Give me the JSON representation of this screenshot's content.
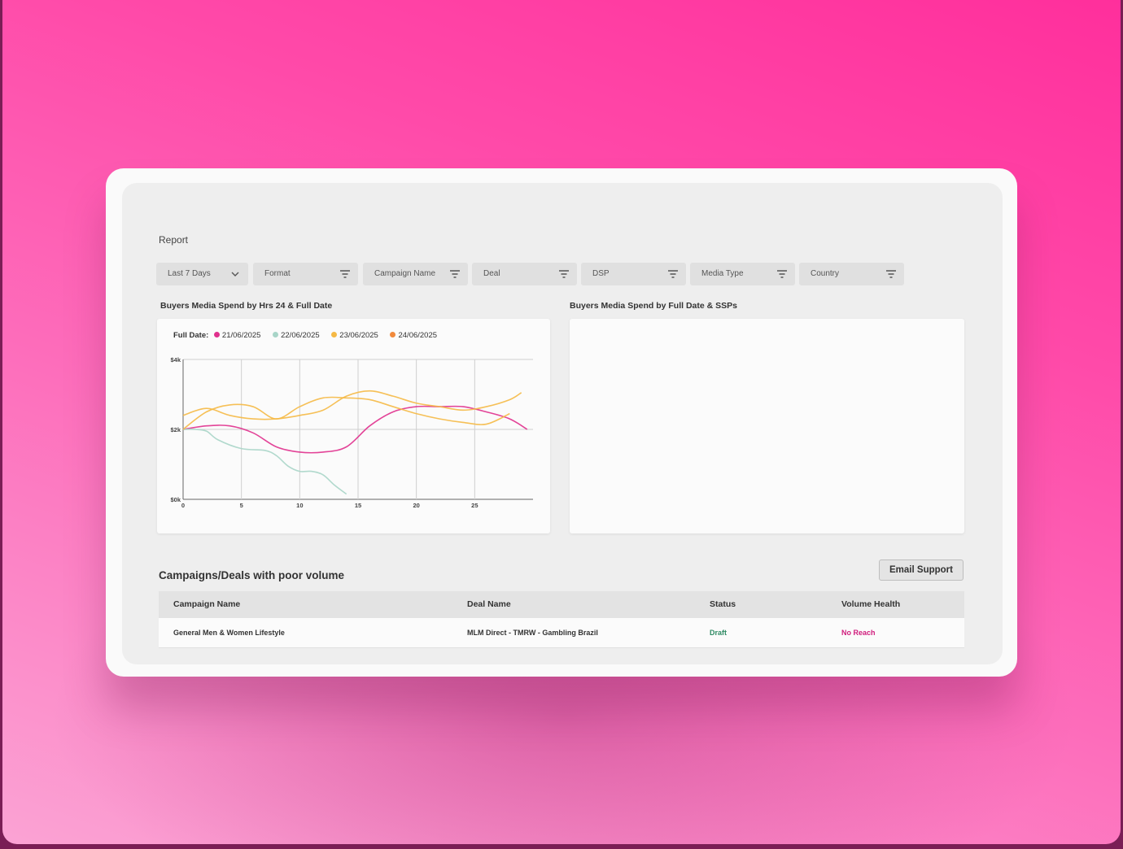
{
  "page": {
    "title": "Report"
  },
  "filters": [
    {
      "label": "Last 7 Days",
      "icon": "chevron-down-icon"
    },
    {
      "label": "Format",
      "icon": "filter-icon"
    },
    {
      "label": "Campaign Name",
      "icon": "filter-icon"
    },
    {
      "label": "Deal",
      "icon": "filter-icon"
    },
    {
      "label": "DSP",
      "icon": "filter-icon"
    },
    {
      "label": "Media Type",
      "icon": "filter-icon"
    },
    {
      "label": "Country",
      "icon": "filter-icon"
    }
  ],
  "colors": {
    "background": "#ff3fa4",
    "series_1": "#e0308d",
    "series_2": "#a8d5c8",
    "series_3": "#f5b945",
    "series_4": "#f18a3c",
    "status_draft": "#2e8a63",
    "health_no_reach": "#d01d7d"
  },
  "chart_data": [
    {
      "type": "line",
      "title": "Buyers Media Spend by Hrs 24 & Full Date",
      "legend_title": "Full Date:",
      "legend_position": "top-left",
      "grid": true,
      "xlim": [
        0,
        30
      ],
      "ylim": [
        0,
        4000
      ],
      "x_ticks": [
        0,
        5,
        10,
        15,
        20,
        25
      ],
      "y_ticks": [
        0,
        2000,
        4000
      ],
      "y_tick_labels": [
        "$0k",
        "$2k",
        "$4k"
      ],
      "series": [
        {
          "name": "21/06/2025",
          "color": "#e0308d",
          "x": [
            0,
            2,
            4,
            6,
            8,
            10,
            12,
            14,
            16,
            18,
            20,
            22,
            24,
            26,
            28,
            29.5
          ],
          "y": [
            2000,
            2100,
            2100,
            1900,
            1500,
            1350,
            1350,
            1500,
            2100,
            2500,
            2650,
            2650,
            2650,
            2500,
            2300,
            2000
          ]
        },
        {
          "name": "22/06/2025",
          "color": "#a8d5c8",
          "x": [
            0,
            1,
            2,
            3,
            5,
            7,
            8,
            9,
            10,
            11,
            12,
            13,
            14
          ],
          "y": [
            2000,
            2000,
            1950,
            1700,
            1450,
            1400,
            1250,
            950,
            800,
            800,
            700,
            400,
            150
          ]
        },
        {
          "name": "23/06/2025",
          "color": "#f5b945",
          "x": [
            0,
            2,
            4,
            6,
            8,
            10,
            12,
            14,
            16,
            18,
            20,
            22,
            24,
            26,
            28,
            29
          ],
          "y": [
            2400,
            2600,
            2400,
            2300,
            2300,
            2400,
            2550,
            2950,
            3100,
            2950,
            2750,
            2650,
            2550,
            2650,
            2850,
            3050
          ]
        },
        {
          "name": "24/06/2025",
          "color": "#f5b945",
          "x": [
            0,
            2,
            4,
            6,
            8,
            10,
            12,
            14,
            16,
            18,
            20,
            22,
            24,
            26,
            28
          ],
          "y": [
            2000,
            2500,
            2700,
            2650,
            2300,
            2650,
            2900,
            2900,
            2850,
            2650,
            2450,
            2300,
            2200,
            2150,
            2450
          ]
        }
      ]
    },
    {
      "type": "line",
      "title": "Buyers Media Spend by Full Date & SSPs",
      "series": []
    }
  ],
  "table": {
    "title": "Campaigns/Deals with poor volume",
    "action_label": "Email Support",
    "columns": [
      "Campaign  Name",
      "Deal Name",
      "Status",
      "Volume Health"
    ],
    "rows": [
      {
        "campaign": "General Men & Women Lifestyle",
        "deal": "MLM Direct - TMRW - Gambling Brazil",
        "status": "Draft",
        "health": "No Reach"
      }
    ]
  }
}
